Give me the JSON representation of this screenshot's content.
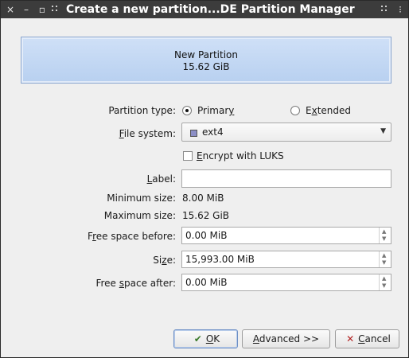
{
  "window": {
    "title": "Create a new partition...DE Partition Manager",
    "controls": {
      "close": "×",
      "minimize": "–",
      "maximize": "▫"
    }
  },
  "preview": {
    "name": "New Partition",
    "size": "15.62 GiB"
  },
  "form": {
    "partition_type_label": {
      "pre": "Partition type:",
      "u": "",
      "post": ""
    },
    "primary": {
      "pre": "Primar",
      "u": "y",
      "post": "",
      "selected": true
    },
    "extended": {
      "pre": "E",
      "u": "x",
      "post": "tended",
      "selected": false
    },
    "file_system_label": {
      "pre": "",
      "u": "F",
      "post": "ile system:"
    },
    "file_system_value": "ext4",
    "encrypt": {
      "pre": "",
      "u": "E",
      "post": "ncrypt with LUKS",
      "checked": false
    },
    "label_label": {
      "pre": "",
      "u": "L",
      "post": "abel:"
    },
    "label_value": "",
    "min_size_label": "Minimum size:",
    "min_size_value": "8.00 MiB",
    "max_size_label": "Maximum size:",
    "max_size_value": "15.62 GiB",
    "free_before_label": {
      "pre": "F",
      "u": "r",
      "post": "ee space before:"
    },
    "free_before_value": "0.00 MiB",
    "size_label": {
      "pre": "Si",
      "u": "z",
      "post": "e:"
    },
    "size_value": "15,993.00 MiB",
    "free_after_label": {
      "pre": "Free ",
      "u": "s",
      "post": "pace after:"
    },
    "free_after_value": "0.00 MiB"
  },
  "buttons": {
    "ok": {
      "pre": "",
      "u": "O",
      "post": "K"
    },
    "advanced": {
      "pre": "",
      "u": "A",
      "post": "dvanced >>"
    },
    "cancel": {
      "pre": "",
      "u": "C",
      "post": "ancel"
    }
  },
  "colors": {
    "titlebar": "#3c3c3c",
    "preview_fill": "#b8d0f0",
    "preview_border": "#8aa6cf"
  }
}
